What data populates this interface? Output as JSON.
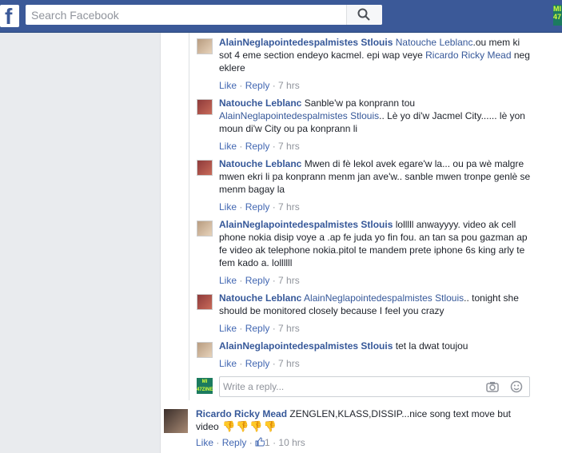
{
  "topbar": {
    "logo": "f",
    "search_placeholder": "Search Facebook",
    "avatar_text": "MI\n47"
  },
  "replies": [
    {
      "name": "AlainNeglapointedespalmistes Stlouis",
      "segments": [
        {
          "type": "tag",
          "text": "Natouche Leblanc"
        },
        {
          "type": "text",
          "text": ".ou mem ki sot 4 eme section endeyo kacmel. epi wap veye "
        },
        {
          "type": "tag",
          "text": "Ricardo Ricky Mead"
        },
        {
          "type": "text",
          "text": " neg eklere"
        }
      ],
      "like": "Like",
      "reply": "Reply",
      "time": "7 hrs"
    },
    {
      "name": "Natouche Leblanc",
      "segments": [
        {
          "type": "text",
          "text": "Sanble'w pa konprann tou "
        },
        {
          "type": "tag",
          "text": "AlainNeglapointedespalmistes Stlouis"
        },
        {
          "type": "text",
          "text": ".. Lè yo di'w Jacmel City...... lè yon moun di'w City ou pa konprann li"
        }
      ],
      "like": "Like",
      "reply": "Reply",
      "time": "7 hrs"
    },
    {
      "name": "Natouche Leblanc",
      "segments": [
        {
          "type": "text",
          "text": "Mwen di fè lekol avek egare'w la... ou pa wè malgre mwen ekri li pa konprann menm jan ave'w.. sanble mwen tronpe genlè se menm bagay la"
        }
      ],
      "like": "Like",
      "reply": "Reply",
      "time": "7 hrs"
    },
    {
      "name": "AlainNeglapointedespalmistes Stlouis",
      "segments": [
        {
          "type": "text",
          "text": "lolllll anwayyyy. video ak cell phone nokia disip voye a .ap fe juda yo fin fou. an tan sa pou gazman ap fe video ak telephone nokia.pitol te mandem prete iphone 6s king arly te fem kado a. lollllll"
        }
      ],
      "like": "Like",
      "reply": "Reply",
      "time": "7 hrs"
    },
    {
      "name": "Natouche Leblanc",
      "segments": [
        {
          "type": "tag",
          "text": "AlainNeglapointedespalmistes Stlouis"
        },
        {
          "type": "text",
          "text": ".. tonight she should be monitored closely because I feel you crazy"
        }
      ],
      "like": "Like",
      "reply": "Reply",
      "time": "7 hrs"
    },
    {
      "name": "AlainNeglapointedespalmistes Stlouis",
      "segments": [
        {
          "type": "text",
          "text": "tet la dwat toujou"
        }
      ],
      "like": "Like",
      "reply": "Reply",
      "time": "7 hrs"
    }
  ],
  "write_reply": {
    "placeholder": "Write a reply...",
    "avatar_text": "MI 47ZINE"
  },
  "main_comment": {
    "name": "Ricardo Ricky Mead",
    "text": "ZENGLEN,KLASS,DISSIP...nice song text move but video",
    "thumbs_down": [
      "👎",
      "👎",
      "👎",
      "👎"
    ],
    "like": "Like",
    "reply": "Reply",
    "like_count": "1",
    "time": "10 hrs"
  }
}
